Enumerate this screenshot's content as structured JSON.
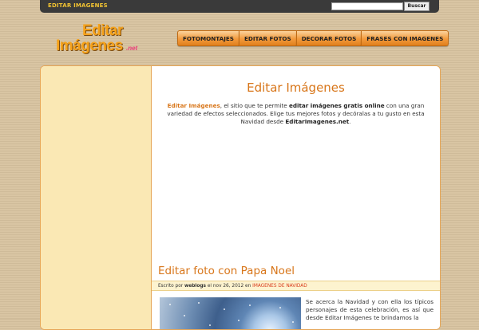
{
  "topbar": {
    "link_label": "EDITAR IMAGENES",
    "search_placeholder": "",
    "search_button_label": "Buscar"
  },
  "logo": {
    "line1": "Editar",
    "line2": "Imágenes",
    "suffix": ".net"
  },
  "nav": {
    "items": [
      {
        "label": "FOTOMONTAJES"
      },
      {
        "label": "EDITAR FOTOS"
      },
      {
        "label": "DECORAR FOTOS"
      },
      {
        "label": "FRASES CON IMAGENES"
      }
    ]
  },
  "main": {
    "title": "Editar Imágenes",
    "intro": {
      "brand": "Editar Imágenes",
      "part1": ", el sitio que te permite ",
      "bold1": "editar imágenes gratis online",
      "part2": " con una gran variedad de efectos seleccionados. Elige tus mejores fotos y decóralas a tu gusto en esta Navidad desde ",
      "bold2": "EditarImagenes.net",
      "part3": "."
    }
  },
  "post": {
    "title": "Editar foto con Papa Noel",
    "meta_prefix": "Escrito por ",
    "author": "weblogs",
    "meta_middle": " el nov 26, 2012 en ",
    "category": "IMAGENES DE NAVIDAD",
    "excerpt": "Se acerca la Navidad y con ella los típicos personajes de esta celebración, es así que desde Editar Imágenes te brindamos la"
  },
  "colors": {
    "accent": "#d8761a",
    "sidebar_bg": "#fae8b4",
    "topbar_bg": "#3a3a3a",
    "topbar_link": "#f1c232",
    "category_link": "#d83a1a"
  }
}
